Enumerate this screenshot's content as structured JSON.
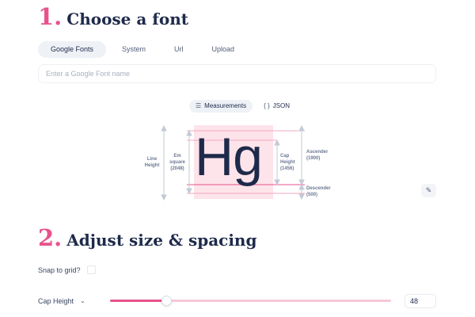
{
  "section1": {
    "number": "1.",
    "title": "Choose a font"
  },
  "tabs": [
    {
      "label": "Google Fonts",
      "active": true
    },
    {
      "label": "System",
      "active": false
    },
    {
      "label": "Url",
      "active": false
    },
    {
      "label": "Upload",
      "active": false
    }
  ],
  "font_input": {
    "placeholder": "Enter a Google Font name",
    "value": ""
  },
  "view_toggle": [
    {
      "label": "Measurements",
      "icon": "list-icon",
      "glyph": "☰",
      "active": true
    },
    {
      "label": "JSON",
      "icon": "braces-icon",
      "glyph": "{ }",
      "active": false
    }
  ],
  "specimen": {
    "text": "Hg",
    "highlight_color": "#fde3ea",
    "labels": {
      "line_height": "Line\nHeight",
      "em_square": "Em\nsquare\n(2048)",
      "cap_height": "Cap\nHeight\n(1456)",
      "ascender": "Ascender\n(1900)",
      "descender": "Descender\n(500)"
    }
  },
  "edit_button": {
    "icon": "edit-icon",
    "glyph": "✎"
  },
  "section2": {
    "number": "2.",
    "title": "Adjust size & spacing"
  },
  "snap": {
    "label": "Snap to grid?",
    "checked": false
  },
  "cap_height": {
    "label": "Cap Height",
    "chevron": "⌄",
    "value": "48",
    "slider_fraction": 0.2
  },
  "colors": {
    "accent": "#e8538c",
    "navy": "#1e2a4a",
    "muted": "#6b7893"
  }
}
